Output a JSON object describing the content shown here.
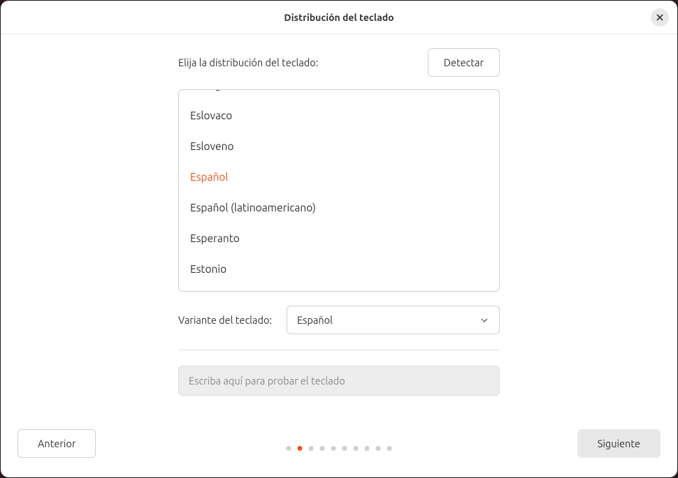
{
  "titlebar": {
    "title": "Distribución del teclado"
  },
  "prompt": {
    "label": "Elija la distribución del teclado:",
    "detect_label": "Detectar"
  },
  "layouts": [
    {
      "name": "Dzongkha",
      "selected": false
    },
    {
      "name": "Eslovaco",
      "selected": false
    },
    {
      "name": "Esloveno",
      "selected": false
    },
    {
      "name": "Español",
      "selected": true
    },
    {
      "name": "Español (latinoamericano)",
      "selected": false
    },
    {
      "name": "Esperanto",
      "selected": false
    },
    {
      "name": "Estonio",
      "selected": false
    }
  ],
  "variant": {
    "label": "Variante del teclado:",
    "selected": "Español"
  },
  "test_input": {
    "placeholder": "Escriba aquí para probar el teclado",
    "value": ""
  },
  "nav": {
    "prev_label": "Anterior",
    "next_label": "Siguiente"
  },
  "progress": {
    "total_steps": 10,
    "current_step": 2
  }
}
